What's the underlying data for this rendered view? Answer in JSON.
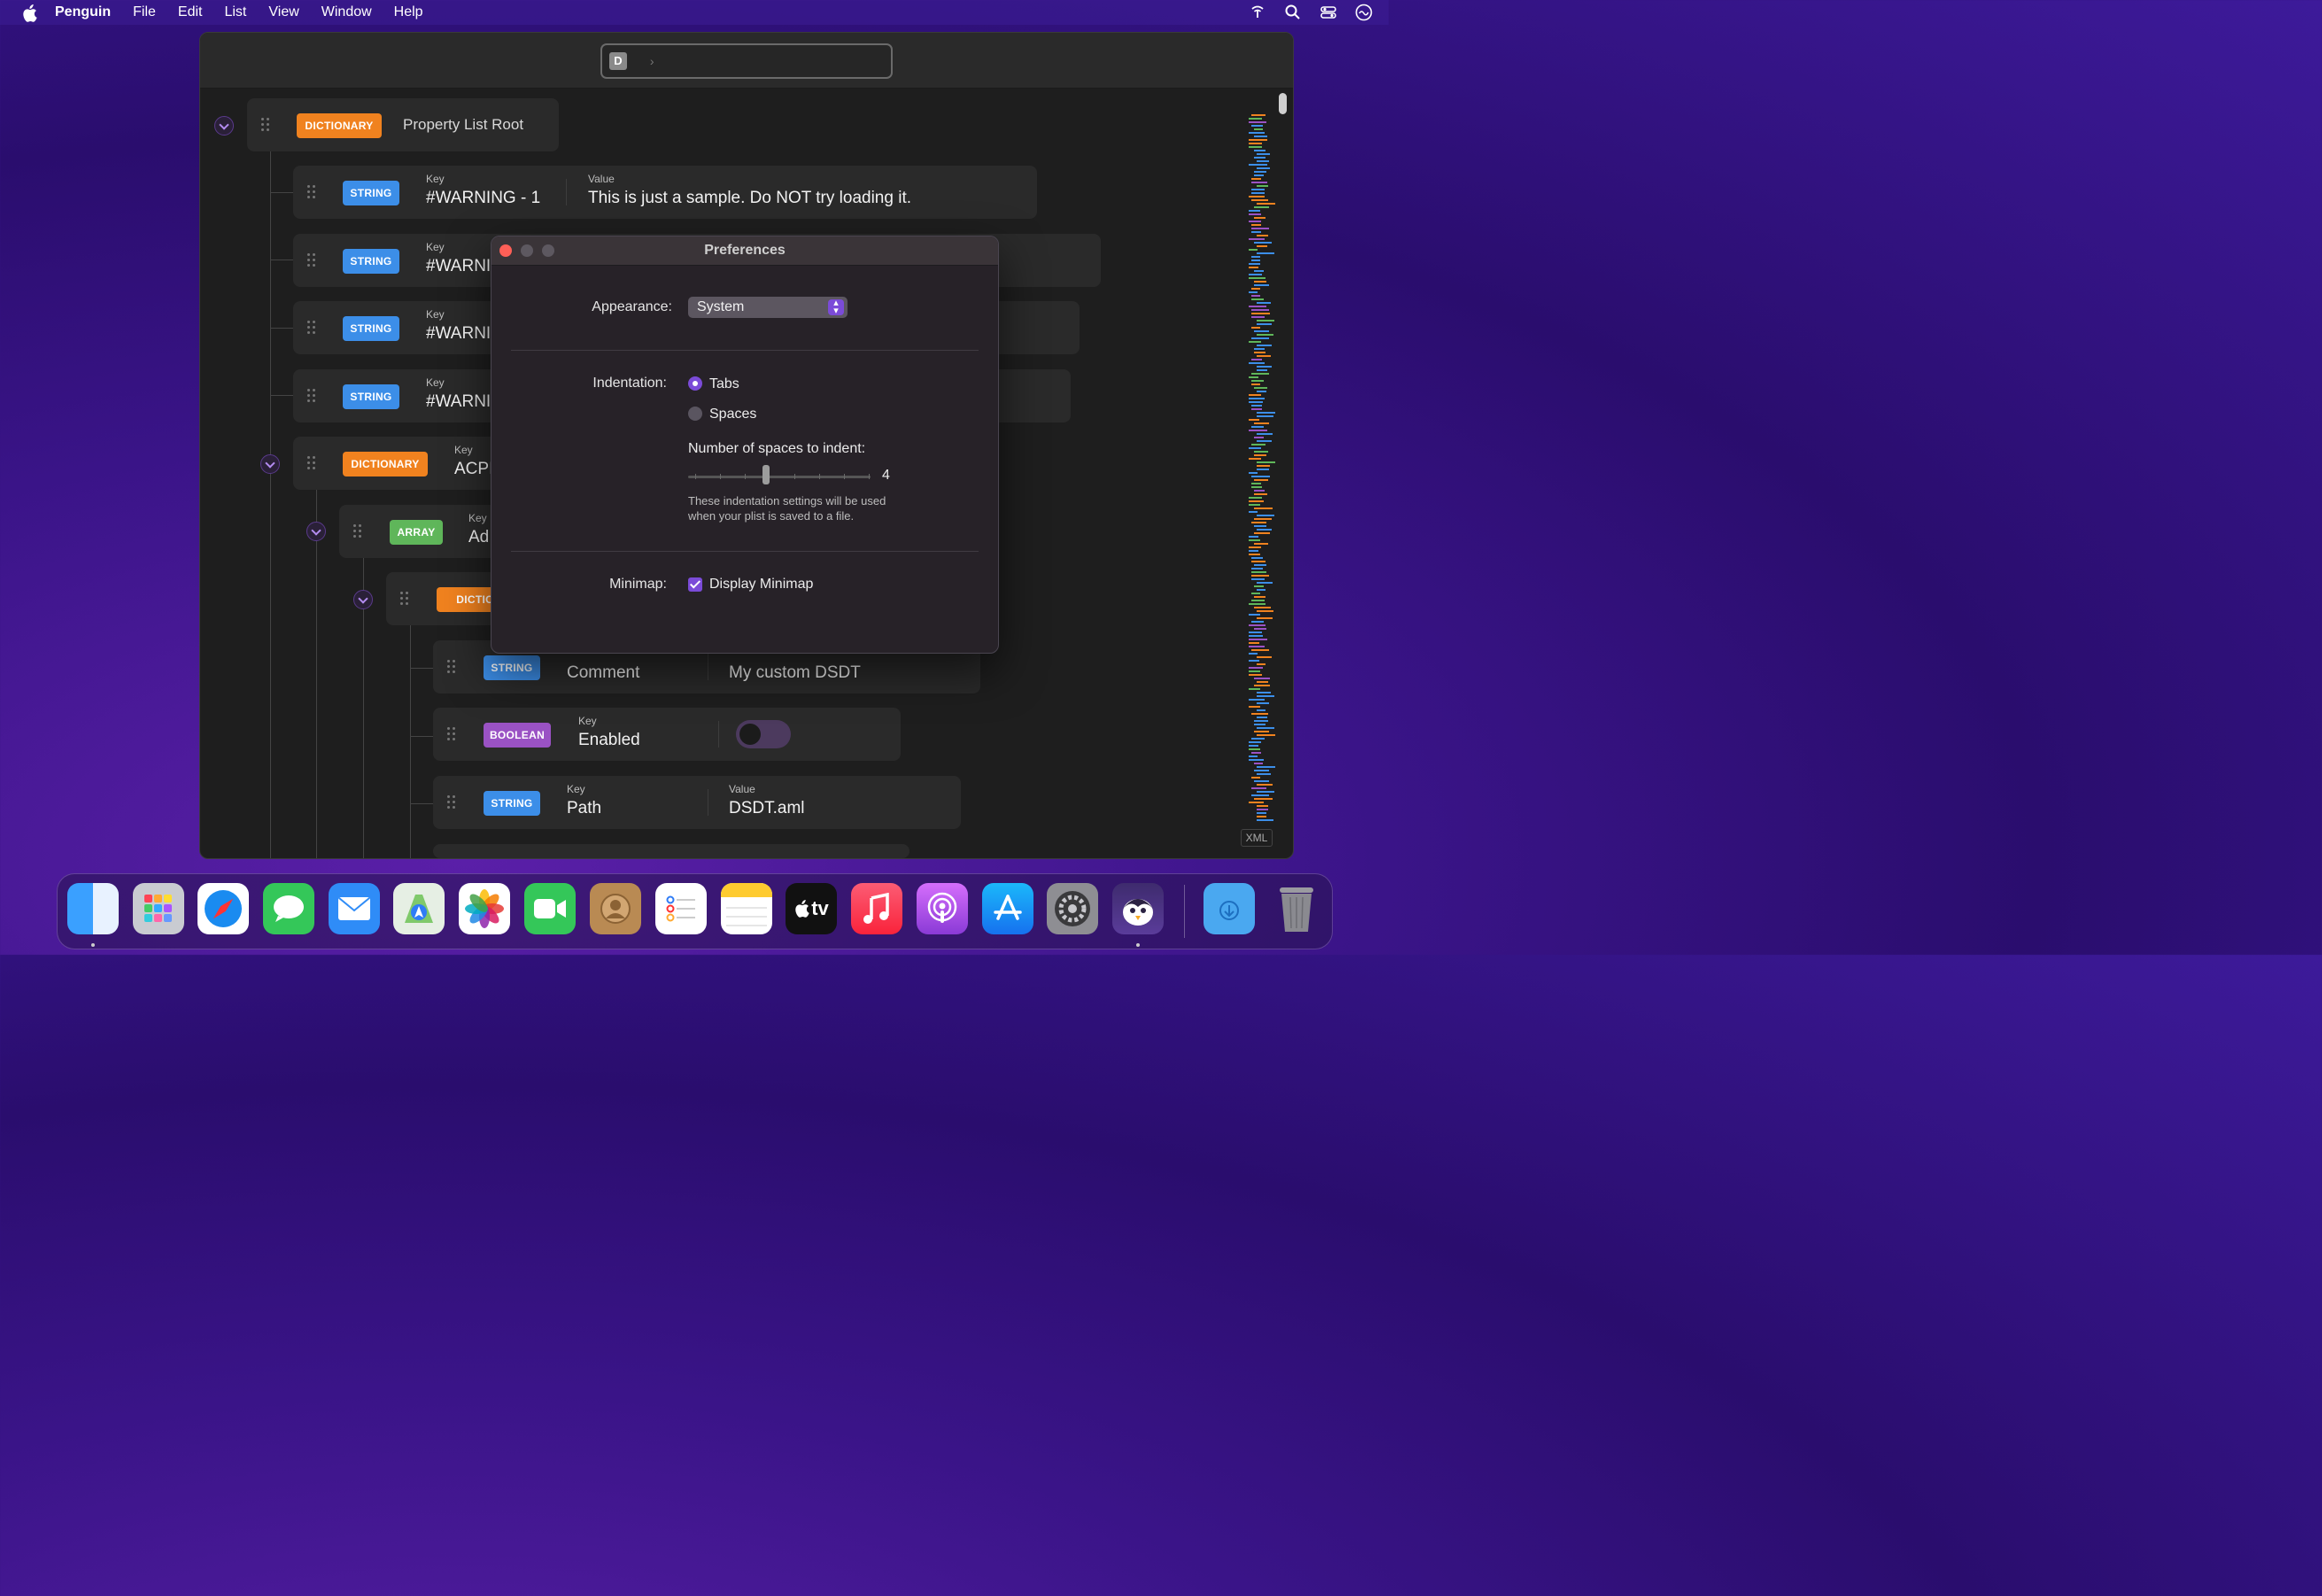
{
  "menubar": {
    "app_name": "Penguin",
    "items": [
      "File",
      "Edit",
      "List",
      "View",
      "Window",
      "Help"
    ]
  },
  "titlebar": {
    "path_icon": "D"
  },
  "rows": {
    "root": {
      "type": "DICTIONARY",
      "label": "Property List Root"
    },
    "r1": {
      "type": "STRING",
      "key_label": "Key",
      "key": "#WARNING - 1",
      "value_label": "Value",
      "value": "This is just a sample. Do NOT try loading it."
    },
    "r2": {
      "type": "STRING",
      "key_label": "Key",
      "key": "#WARNI"
    },
    "r3": {
      "type": "STRING",
      "key_label": "Key",
      "key": "#WARNI"
    },
    "r4": {
      "type": "STRING",
      "key_label": "Key",
      "key": "#WARNI"
    },
    "r5": {
      "type": "DICTIONARY",
      "key_label": "Key",
      "key": "ACPI"
    },
    "r6": {
      "type": "ARRAY",
      "key_label": "Key",
      "key": "Ad"
    },
    "r7": {
      "type": "DICTION"
    },
    "r8": {
      "type": "STRING",
      "key": "Comment",
      "value": "My custom DSDT"
    },
    "r9": {
      "type": "BOOLEAN",
      "key_label": "Key",
      "key": "Enabled"
    },
    "r10": {
      "type": "STRING",
      "key_label": "Key",
      "key": "Path",
      "value_label": "Value",
      "value": "DSDT.aml"
    }
  },
  "minimap_tag": "XML",
  "preferences": {
    "title": "Preferences",
    "appearance_label": "Appearance:",
    "appearance_value": "System",
    "indentation_label": "Indentation:",
    "opt_tabs": "Tabs",
    "opt_spaces": "Spaces",
    "indentation_selected": "Tabs",
    "spaces_label": "Number of spaces to indent:",
    "spaces_value": "4",
    "note_line1": "These indentation settings will be used",
    "note_line2": "when your plist is saved to a file.",
    "minimap_label": "Minimap:",
    "minimap_option": "Display Minimap",
    "minimap_checked": true
  },
  "dock": [
    "finder-icon",
    "launchpad-icon",
    "safari-icon",
    "messages-icon",
    "mail-icon",
    "maps-icon",
    "photos-icon",
    "facetime-icon",
    "contacts-icon",
    "reminders-icon",
    "notes-icon",
    "tv-icon",
    "music-icon",
    "podcasts-icon",
    "app-store-icon",
    "system-preferences-icon",
    "penguin-icon",
    "downloads-folder-icon",
    "trash-icon"
  ],
  "dock_tv_label": "tv",
  "colors": {
    "dictionary": "#f0821f",
    "string": "#3c8ee8",
    "array": "#5fb65a",
    "boolean": "#9a52c4",
    "accent": "#7b4bd8"
  }
}
